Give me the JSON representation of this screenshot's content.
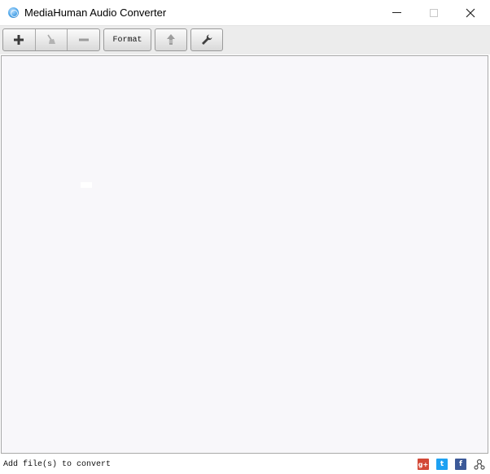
{
  "window": {
    "title": "MediaHuman Audio Converter",
    "icon": "app-globe-icon"
  },
  "toolbar": {
    "add_icon": "plus-icon",
    "clear_icon": "broom-icon",
    "remove_icon": "minus-icon",
    "format_label": "Format",
    "upload_icon": "itunes-upload-icon",
    "settings_icon": "wrench-icon"
  },
  "statusbar": {
    "message": "Add file(s) to convert",
    "social": [
      "google-plus-icon",
      "twitter-icon",
      "facebook-icon",
      "network-icon"
    ],
    "gplus_label": "g+",
    "twitter_label": "t",
    "facebook_label": "f"
  },
  "colors": {
    "list_background": "#f8f7fa",
    "toolbar_background": "#ececec",
    "gplus": "#d34836",
    "twitter": "#1da1f2",
    "facebook": "#3b5998"
  }
}
